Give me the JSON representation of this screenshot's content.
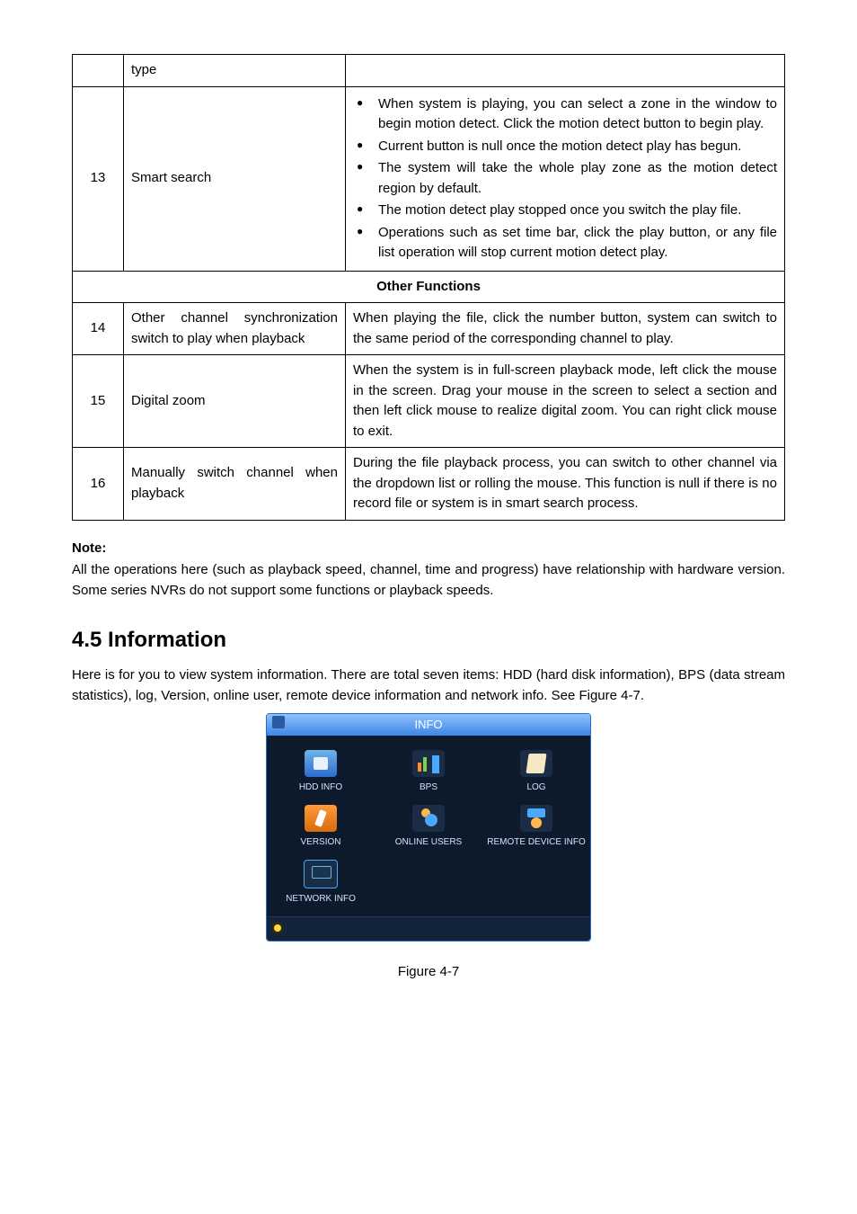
{
  "row_type": {
    "num": "",
    "label": "type",
    "content": ""
  },
  "row13": {
    "num": "13",
    "label": "Smart search",
    "bullets": [
      "When system is playing, you can select a zone in the window to begin motion detect. Click the motion detect button to begin play.",
      "Current button is null once the motion detect play has begun.",
      "The system will take the whole play zone as the motion detect region by default.",
      "The motion detect play stopped once you switch the play file.",
      "Operations such as set time bar, click the play button, or any file list operation will stop current motion detect play."
    ]
  },
  "other_header": "Other Functions",
  "row14": {
    "num": "14",
    "label": "Other channel synchronization switch to play when playback",
    "desc": "When playing the file, click the number button, system can switch to the same period of the corresponding channel to play."
  },
  "row15": {
    "num": "15",
    "label": "Digital zoom",
    "desc": "When the system is in full-screen playback mode, left click the mouse in the screen. Drag your mouse in the screen to select a section and then left click mouse to realize digital zoom. You can right click mouse to exit."
  },
  "row16": {
    "num": "16",
    "label": "Manually switch channel when playback",
    "desc": "During the file playback process, you can switch to other channel via the dropdown list or rolling the mouse. This function is null if there is no record file or system is in smart search process."
  },
  "note": {
    "title": "Note:",
    "body": "All the operations here (such as playback speed, channel, time and progress) have relationship with hardware version. Some series NVRs do not support some functions or playback speeds."
  },
  "heading": "4.5  Information",
  "section_text": "Here is for you to view system information. There are total seven items: HDD (hard disk information), BPS (data stream statistics), log, Version, online user, remote device information and network info. See Figure 4-7.",
  "info": {
    "title": "INFO",
    "items": [
      "HDD INFO",
      "BPS",
      "LOG",
      "VERSION",
      "ONLINE USERS",
      "REMOTE DEVICE INFO",
      "NETWORK INFO"
    ]
  },
  "figure_caption": "Figure 4-7"
}
